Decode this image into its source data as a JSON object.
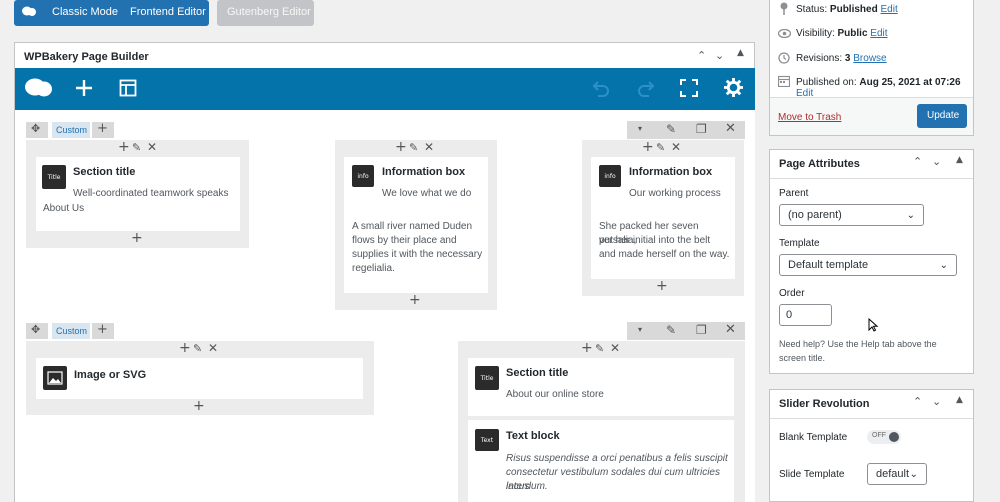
{
  "editor_modes": {
    "classic_label": "Classic Mode",
    "frontend_label": "Frontend Editor",
    "gutenberg_label": "Gutenberg Editor"
  },
  "builder": {
    "title": "WPBakery Page Builder"
  },
  "rows": [
    {
      "custom_label": "Custom",
      "columns": [
        {
          "elements": [
            {
              "icon": "Title",
              "title": "Section title",
              "lines": [
                "Well-coordinated teamwork speaks",
                "About Us"
              ]
            }
          ]
        },
        {
          "elements": [
            {
              "icon": "info",
              "title": "Information box",
              "subtitle": "We love what we do",
              "body": [
                "A small river named Duden",
                "flows by their place and",
                "supplies it with the necessary",
                "regelialia."
              ]
            }
          ]
        },
        {
          "elements": [
            {
              "icon": "info",
              "title": "Information box",
              "subtitle": "Our working process",
              "body": [
                "She packed her seven versalia,",
                "put her initial into the belt",
                "and made herself on the way."
              ]
            }
          ]
        }
      ]
    },
    {
      "custom_label": "Custom",
      "columns": [
        {
          "elements": [
            {
              "icon": "image",
              "title": "Image or SVG"
            }
          ]
        },
        {
          "elements": [
            {
              "icon": "Title",
              "title": "Section title",
              "subtitle": "About our online store"
            },
            {
              "icon": "Text",
              "title": "Text block",
              "body": [
                "Risus suspendisse a orci penatibus a felis suscipit",
                "consectetur vestibulum sodales dui cum ultricies lacus",
                "interdum."
              ]
            }
          ]
        }
      ]
    }
  ],
  "publish": {
    "status_label": "Status:",
    "status_value": "Published",
    "status_edit": "Edit",
    "visibility_label": "Visibility:",
    "visibility_value": "Public",
    "visibility_edit": "Edit",
    "revisions_label": "Revisions:",
    "revisions_value": "3",
    "revisions_browse": "Browse",
    "published_label": "Published on:",
    "published_value": "Aug 25, 2021 at 07:26",
    "published_edit": "Edit",
    "trash_label": "Move to Trash",
    "update_label": "Update"
  },
  "page_attributes": {
    "title": "Page Attributes",
    "parent_label": "Parent",
    "parent_value": "(no parent)",
    "template_label": "Template",
    "template_value": "Default template",
    "order_label": "Order",
    "order_value": "0",
    "help_text_1": "Need help? Use the Help tab above the",
    "help_text_2": "screen title."
  },
  "slider_revolution": {
    "title": "Slider Revolution",
    "blank_template_label": "Blank Template",
    "blank_template_toggle": "OFF",
    "slide_template_label": "Slide Template",
    "slide_template_value": "default"
  },
  "colors": {
    "accent": "#2271b1",
    "builder_bar": "#0473aa"
  }
}
